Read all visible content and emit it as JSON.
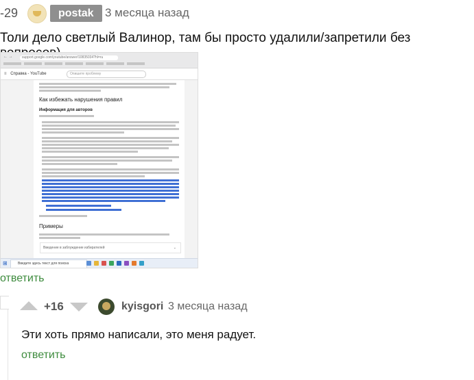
{
  "comment1": {
    "rating": "-29",
    "username": "postak",
    "time": "3 месяца назад",
    "text": "Толи дело светлый Валинор, там бы просто удалили/запретили без вопросов)",
    "reply_label": "ответить"
  },
  "screenshot": {
    "url": "support.google.com/youtube/answer/10835034?hl=ru",
    "page_title": "Справка - YouTube",
    "search_placeholder": "Опишите проблему",
    "heading": "Как избежать нарушения правил",
    "subheading": "Информация для авторов",
    "examples_heading": "Примеры",
    "accordion_label": "Введение в заблуждение избирателей",
    "taskbar_search": "Введите здесь текст для поиска"
  },
  "comment2": {
    "score": "+16",
    "username": "kyisgori",
    "time": "3 месяца назад",
    "text": "Эти хоть прямо написали, это меня радует.",
    "reply_label": "ответить"
  },
  "colors": {
    "reply_link": "#3d8b3d",
    "username_badge": "#8f8f8f",
    "highlight": "#3f6fd4"
  }
}
